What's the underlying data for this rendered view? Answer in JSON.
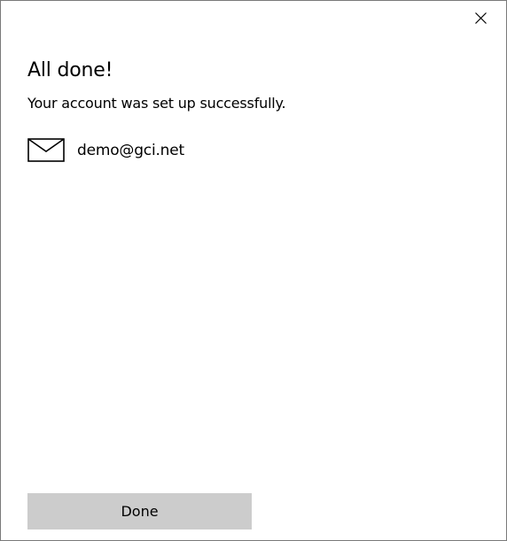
{
  "dialog": {
    "title": "All done!",
    "subtitle": "Your account was set up successfully.",
    "close_icon": "close-icon",
    "account": {
      "icon": "mail-icon",
      "email": "demo@gci.net"
    },
    "done_label": "Done"
  },
  "colors": {
    "border": "#7a7a7a",
    "button_bg": "#cccccc",
    "text": "#000000",
    "background": "#ffffff"
  }
}
